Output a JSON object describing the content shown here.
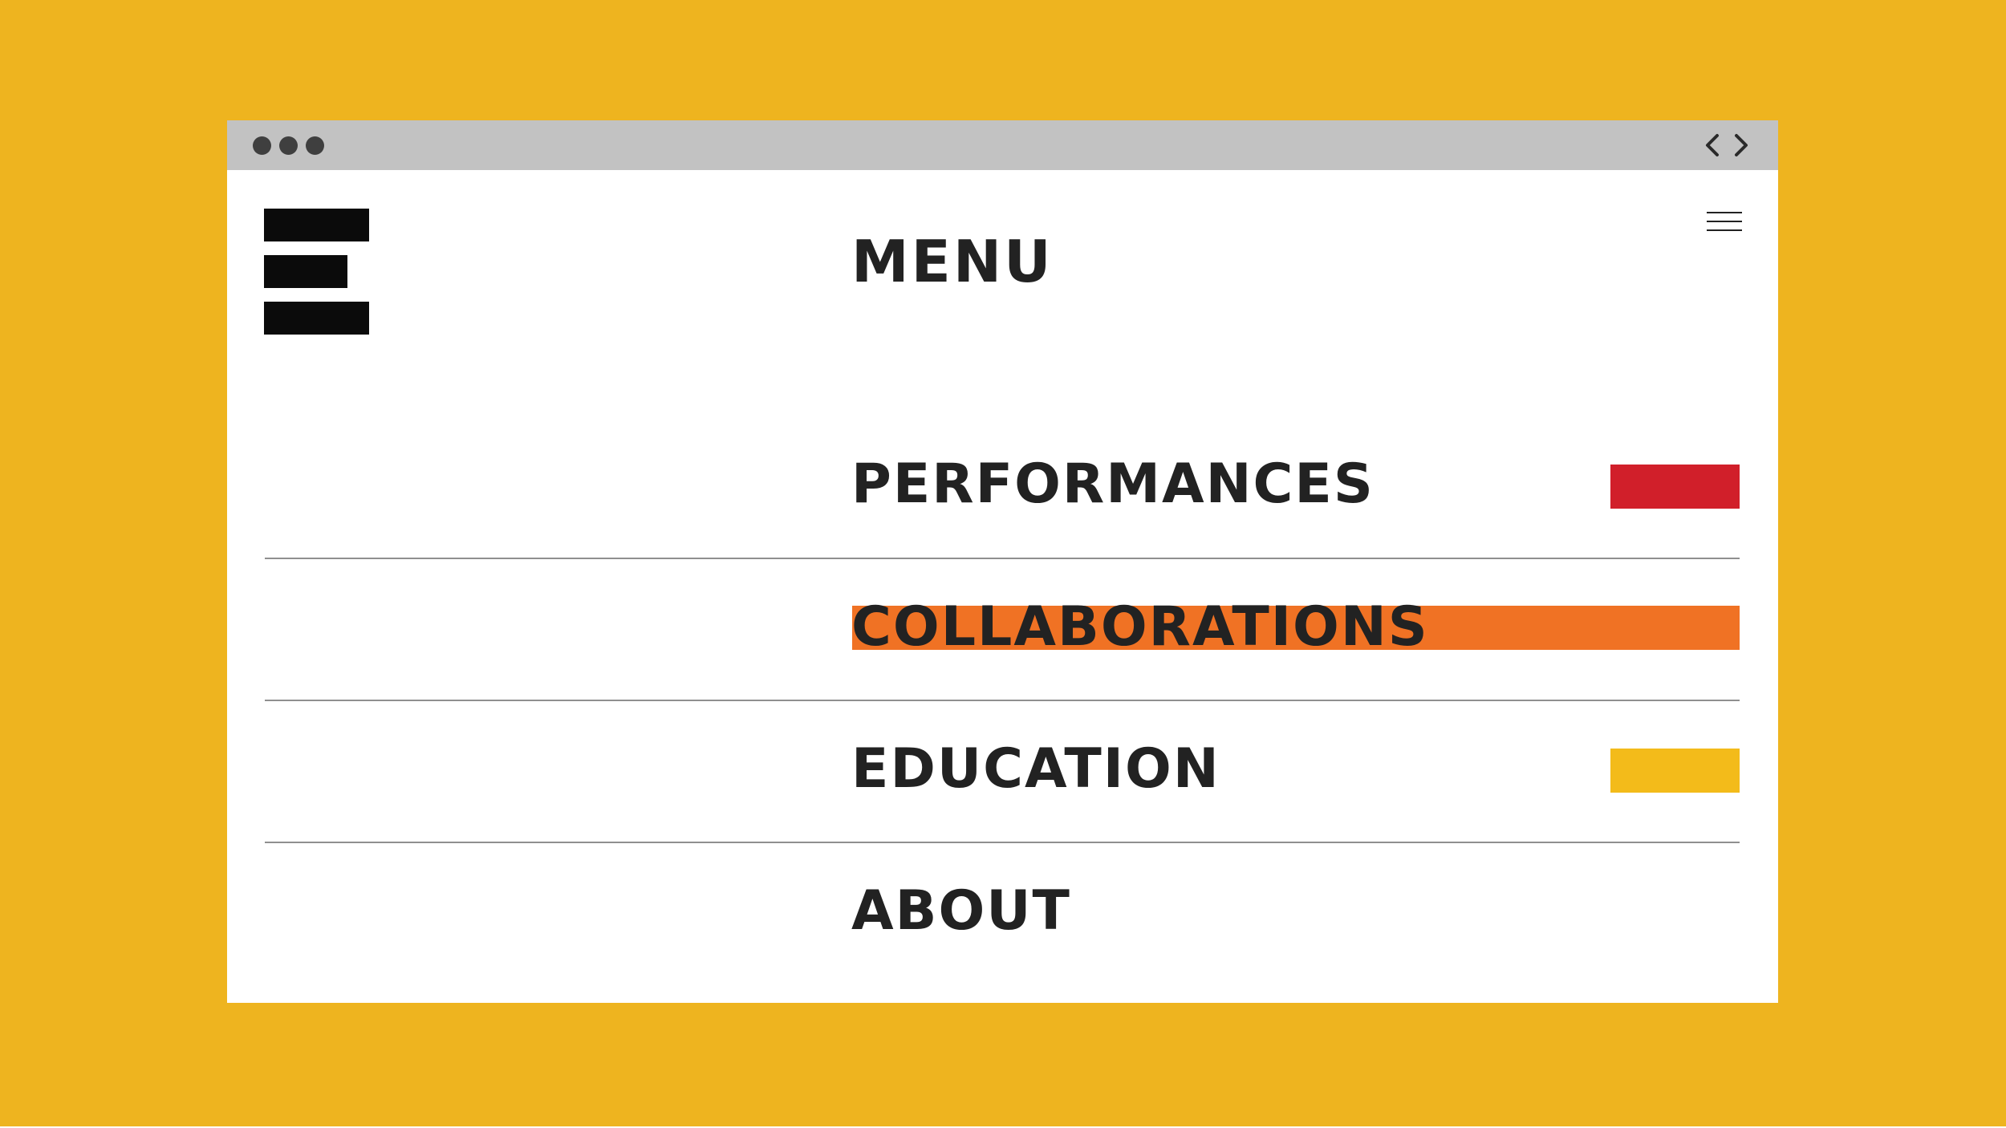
{
  "colors": {
    "background": "#EEB41F",
    "titlebar": "#C2C2C2",
    "window": "#FFFFFF",
    "text": "#222222",
    "logo": "#0B0B0B",
    "performances_marker": "#D11F2A",
    "collaborations_highlight": "#F07224",
    "education_marker": "#F3BB1A",
    "divider": "#8F8F8F"
  },
  "browser": {
    "window_controls": [
      "dot",
      "dot",
      "dot"
    ],
    "nav_icons": [
      "chevron-left-icon",
      "chevron-right-icon"
    ]
  },
  "header": {
    "logo_icon": "bar-logo-icon",
    "menu_icon": "hamburger-menu-icon"
  },
  "menu": {
    "title": "MENU",
    "items": [
      {
        "label": "PERFORMANCES",
        "marker": "red-swatch"
      },
      {
        "label": "COLLABORATIONS",
        "marker": "orange-highlight"
      },
      {
        "label": "EDUCATION",
        "marker": "yellow-swatch"
      },
      {
        "label": "ABOUT",
        "marker": ""
      }
    ]
  }
}
